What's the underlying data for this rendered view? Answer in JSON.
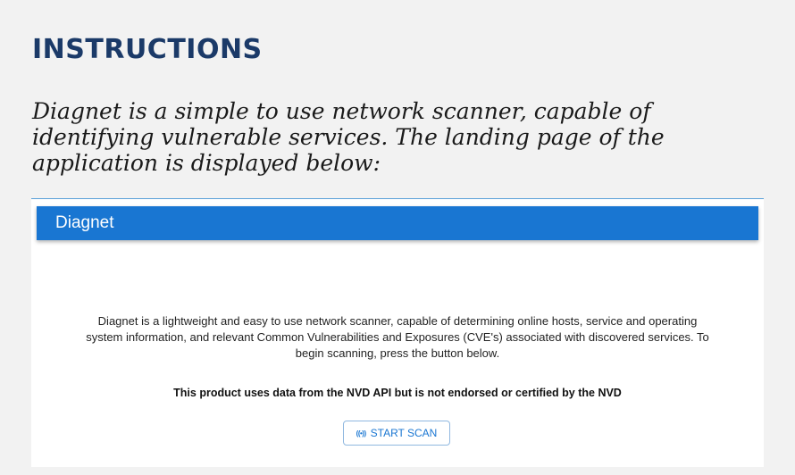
{
  "heading": "INSTRUCTIONS",
  "intro": "Diagnet is a simple to use network scanner, capable of identifying vulnerable services. The landing page of the application is displayed below:",
  "app": {
    "title": "Diagnet",
    "description": "Diagnet is a lightweight and easy to use network scanner, capable of determining online hosts, service and operating system information, and relevant Common Vulnerabilities and Exposures (CVE's) associated with discovered services. To begin scanning, press the button below.",
    "disclaimer": "This product uses data from the NVD API but is not endorsed or certified by the NVD",
    "scan_button": {
      "icon": "broadcast-icon",
      "icon_glyph": "((•))",
      "label": "START SCAN"
    }
  },
  "colors": {
    "heading": "#1b3a68",
    "appbar": "#1976d2",
    "button_text": "#1976d2"
  }
}
